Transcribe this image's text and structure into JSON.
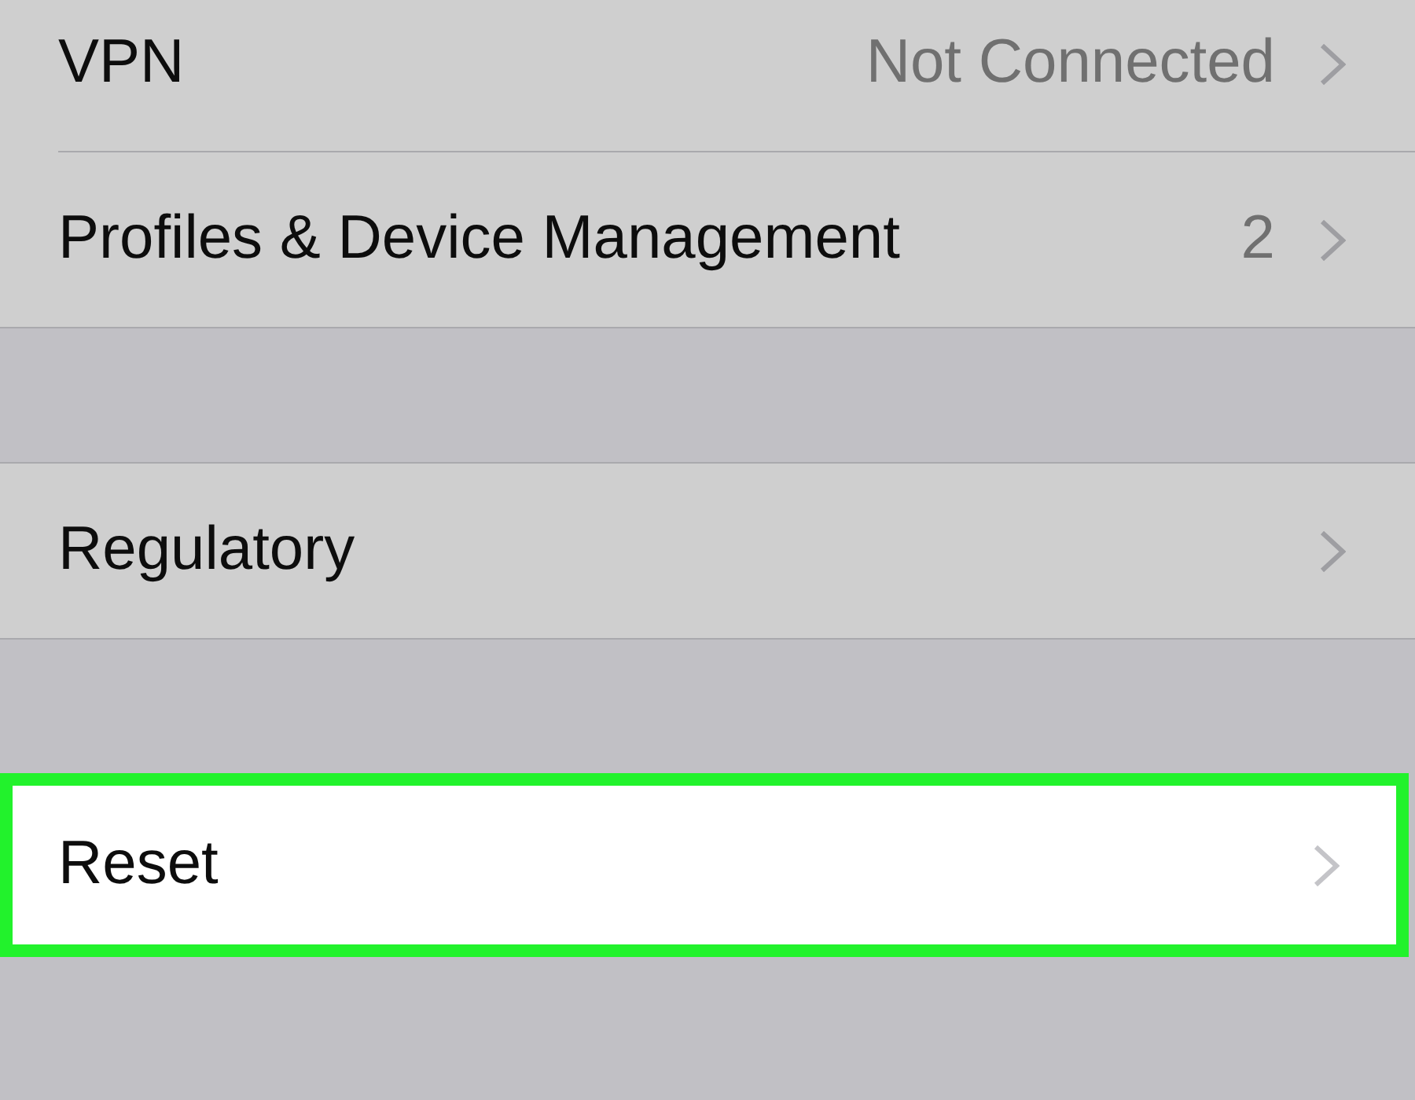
{
  "groups": [
    {
      "rows": [
        {
          "label": "VPN",
          "value": "Not Connected",
          "highlighted": false
        },
        {
          "label": "Profiles & Device Management",
          "value": "2",
          "highlighted": false
        }
      ]
    },
    {
      "rows": [
        {
          "label": "Regulatory",
          "highlighted": false
        }
      ]
    },
    {
      "rows": [
        {
          "label": "Reset",
          "highlighted": true
        }
      ]
    }
  ]
}
